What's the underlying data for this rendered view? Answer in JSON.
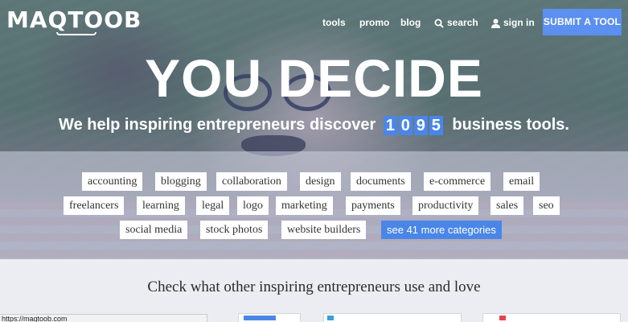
{
  "brand": {
    "logo_text": "MAQTOOB"
  },
  "nav": {
    "tools": "tools",
    "promo": "promo",
    "blog": "blog",
    "search": "search",
    "sign_in": "sign in",
    "submit": "SUBMIT A TOOL",
    "icons": {
      "search": "search-icon",
      "sign_in": "user-icon"
    }
  },
  "hero": {
    "headline": "YOU DECIDE",
    "sub_before": "We help inspiring entrepreneurs discover",
    "digits": [
      "1",
      "0",
      "9",
      "5"
    ],
    "sub_after": "business tools."
  },
  "categories": {
    "row1": [
      "accounting",
      "blogging",
      "collaboration",
      "design",
      "documents",
      "e-commerce",
      "email"
    ],
    "row2": [
      "freelancers",
      "learning",
      "legal",
      "logo",
      "marketing",
      "payments",
      "productivity",
      "sales",
      "seo"
    ],
    "row3": [
      "social media",
      "stock photos",
      "website builders"
    ],
    "more": "see 41 more categories"
  },
  "section": {
    "title": "Check what other inspiring entrepreneurs use and love"
  },
  "status_bar": {
    "url": "https://maqtoob.com"
  },
  "colors": {
    "accent": "#4a86e8",
    "submit": "#5b8ff0",
    "overlay": "#5f6eaa",
    "page_bg": "#ecedf2"
  }
}
